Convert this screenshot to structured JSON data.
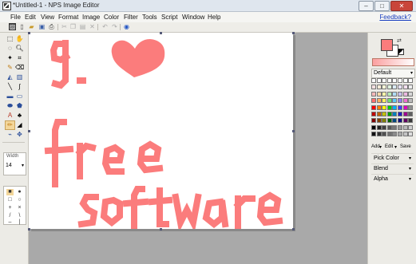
{
  "window": {
    "title": "*Untitled-1 - NPS Image Editor",
    "controls": {
      "minimize": "–",
      "maximize": "□",
      "close": "✕"
    }
  },
  "menu": {
    "items": [
      "File",
      "Edit",
      "View",
      "Format",
      "Image",
      "Color",
      "Filter",
      "Tools",
      "Script",
      "Window",
      "Help"
    ],
    "feedback": "Feedback?"
  },
  "toolbar": {
    "icons": [
      "screenshot-icon",
      "new-icon",
      "open-icon",
      "save-icon",
      "print-icon",
      "cut-icon",
      "copy-icon",
      "paste-icon",
      "delete-icon",
      "undo-icon",
      "redo-icon",
      "help-icon"
    ]
  },
  "tools": {
    "width_label": "Width",
    "width_value": "14",
    "selected": "pencil-tool"
  },
  "right_panel": {
    "foreground_color": "#fb7c7c",
    "background_color": "#ffffff",
    "palette_name": "Default",
    "palette_links": {
      "add": "Add",
      "edit": "Edit",
      "save": "Save"
    },
    "pick_color": "Pick Color",
    "blend": "Blend",
    "alpha": "Alpha"
  },
  "drawing": {
    "stroke_color": "#fb7c7c",
    "words": [
      "9.",
      "free",
      "software"
    ],
    "shape": "heart"
  }
}
